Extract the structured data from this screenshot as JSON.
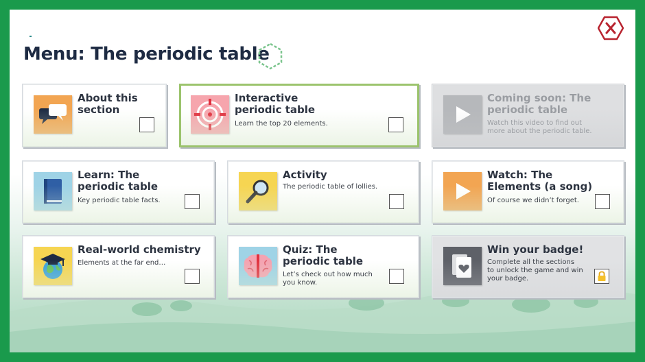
{
  "header": {
    "title": "Menu: The periodic table"
  },
  "colors": {
    "frame": "#1a9a4c",
    "title": "#1e2b43",
    "active_border": "#9bc36c",
    "close": "#b8232f"
  },
  "cards": [
    {
      "title_line1": "About this",
      "title_line2": "section",
      "desc": "",
      "icon": "speech-bubbles-icon",
      "state": "unchecked"
    },
    {
      "title_line1": "Interactive",
      "title_line2": "periodic table",
      "desc": "Learn the top 20 elements.",
      "icon": "target-icon",
      "state": "unchecked"
    },
    {
      "title_line1": "Coming soon: The",
      "title_line2": "periodic table",
      "desc_line1": "Watch this video to find out",
      "desc_line2": "more about the periodic table.",
      "icon": "play-icon",
      "state": "disabled"
    },
    {
      "title_line1": "Learn: The",
      "title_line2": "periodic table",
      "desc": "Key periodic table facts.",
      "icon": "book-icon",
      "state": "unchecked"
    },
    {
      "title_line1": "Activity",
      "desc": "The periodic table of lollies.",
      "icon": "magnifier-icon",
      "state": "unchecked"
    },
    {
      "title_line1": "Watch: The",
      "title_line2": "Elements (a song)",
      "desc": "Of course we didn’t forget.",
      "icon": "play-icon",
      "state": "unchecked"
    },
    {
      "title_line1": "Real-world chemistry",
      "desc": "Elements at the far end…",
      "icon": "globe-graduation-icon",
      "state": "unchecked"
    },
    {
      "title_line1": "Quiz: The",
      "title_line2": "periodic table",
      "desc_line1": "Let’s check out how much",
      "desc_line2": "you know.",
      "icon": "brain-icon",
      "state": "unchecked"
    },
    {
      "title_line1": "Win your badge!",
      "desc_line1": "Complete all the sections",
      "desc_line2": "to unlock the game and win",
      "desc_line3": "your badge.",
      "icon": "card-heart-icon",
      "state": "locked"
    }
  ]
}
